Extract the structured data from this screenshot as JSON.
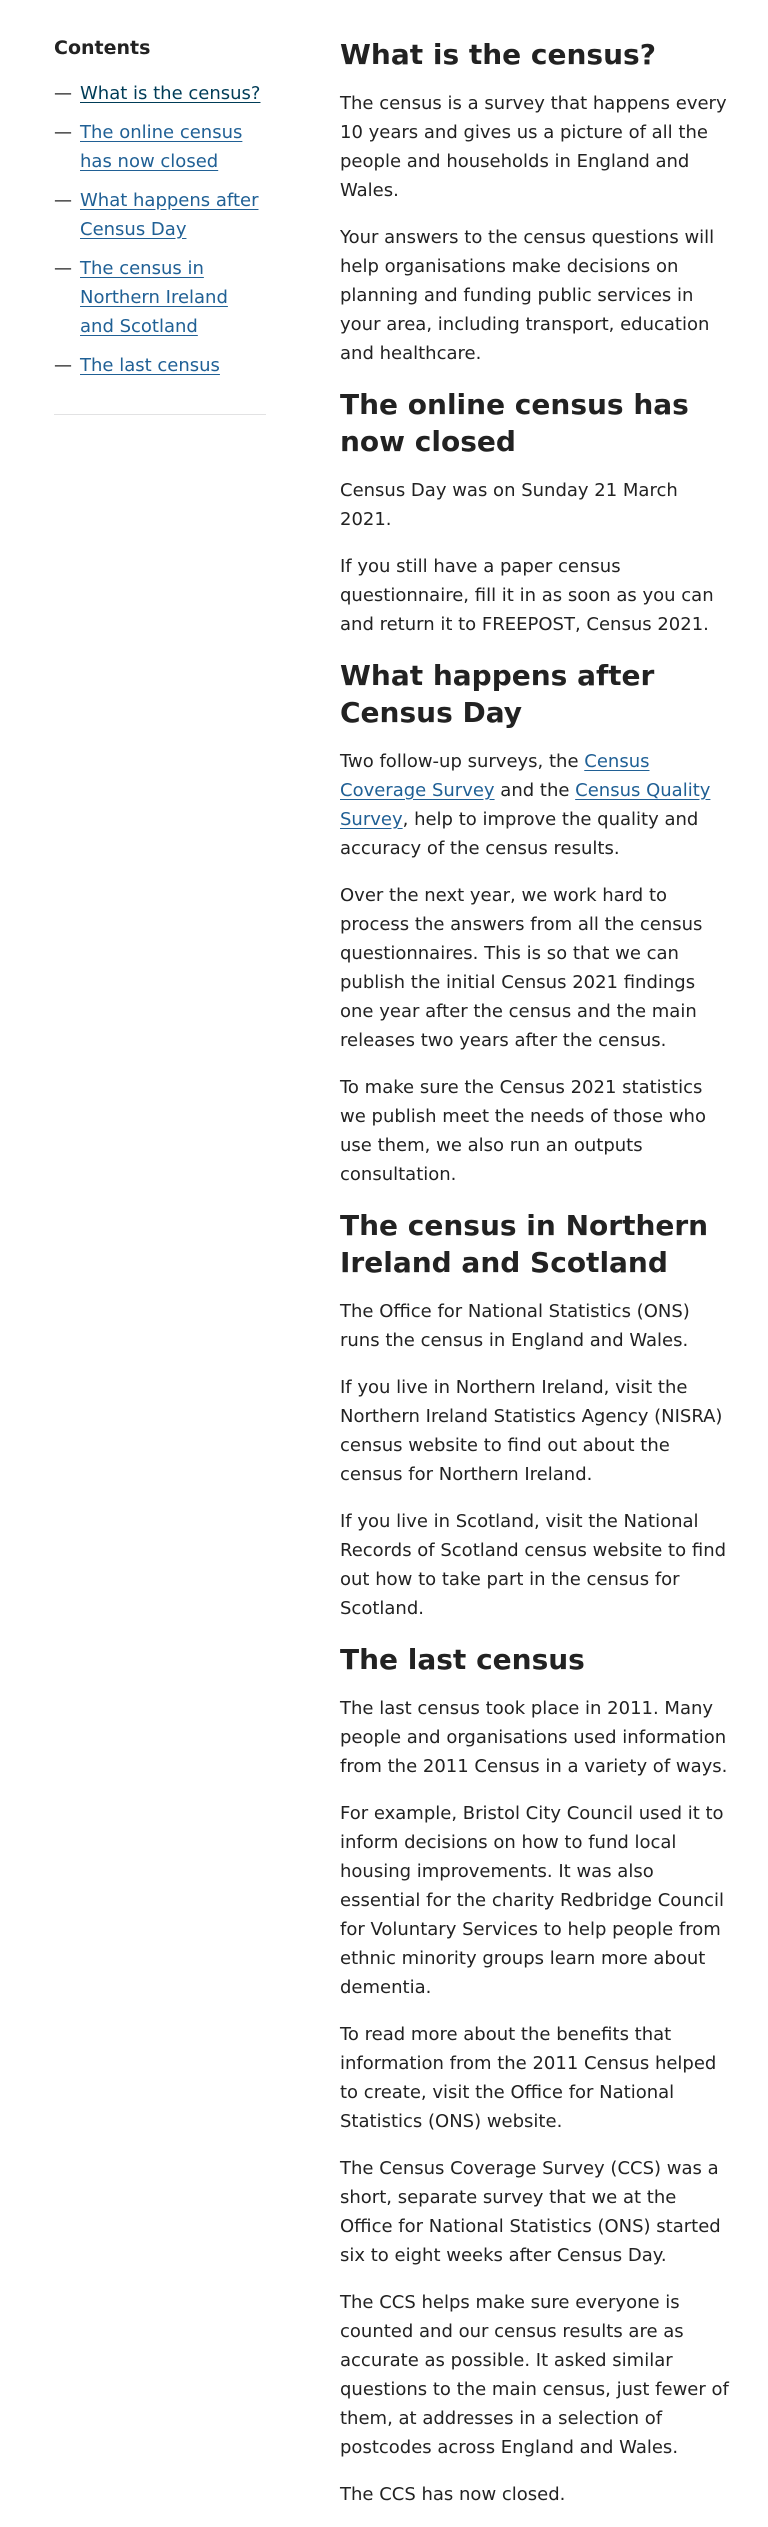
{
  "toc": {
    "title": "Contents",
    "dash": "—",
    "items": [
      {
        "label": "What is the census?"
      },
      {
        "label": "The online census has now closed"
      },
      {
        "label": "What happens after Census Day"
      },
      {
        "label": "The census in Northern Ireland and Scotland"
      },
      {
        "label": "The last census"
      }
    ]
  },
  "sections": {
    "what": {
      "heading": "What is the census?",
      "p1": "The census is a survey that happens every 10 years and gives us a picture of all the people and households in England and Wales.",
      "p2": "Your answers to the census questions will help organisations make decisions on planning and funding public services in your area, including transport, education and healthcare."
    },
    "online": {
      "heading": "The online census has now closed",
      "p1": "Census Day was on Sunday 21 March 2021.",
      "p2": "If you still have a paper census questionnaire, fill it in as soon as you can and return it to FREEPOST, Census 2021."
    },
    "after": {
      "heading": "What happens after Census Day",
      "p1_a": "Two follow-up surveys, the ",
      "p1_link1": "Census Coverage Survey",
      "p1_b": " and the ",
      "p1_link2": "Census Quality Survey",
      "p1_c": ", help to improve the quality and accuracy of the census results.",
      "p2": "Over the next year, we work hard to process the answers from all the census questionnaires. This is so that we can publish the initial Census 2021 findings one year after the census and the main releases two years after the census.",
      "p3": "To make sure the Census 2021 statistics we publish meet the needs of those who use them, we also run an outputs consultation."
    },
    "ni": {
      "heading": "The census in Northern Ireland and Scotland",
      "p1": "The Office for National Statistics (ONS) runs the census in England and Wales.",
      "p2": "If you live in Northern Ireland, visit the Northern Ireland Statistics Agency (NISRA) census website to find out about the census for Northern Ireland.",
      "p3": "If you live in Scotland, visit the National Records of Scotland census website to find out how to take part in the census for Scotland."
    },
    "last": {
      "heading": "The last census",
      "p1": "The last census took place in 2011. Many people and organisations used information from the 2011 Census in a variety of ways.",
      "p2": "For example, Bristol City Council used it to inform decisions on how to fund local housing improvements. It was also essential for the charity Redbridge Council for Voluntary Services to help people from ethnic minority groups learn more about dementia.",
      "p3": "To read more about the benefits that information from the 2011 Census helped to create, visit the Office for National Statistics (ONS) website.",
      "p4": "The Census Coverage Survey (CCS) was a short, separate survey that we at the Office for National Statistics (ONS) started six to eight weeks after Census Day.",
      "p5": "The CCS helps make sure everyone is counted and our census results are as accurate as possible. It asked similar questions to the main census, just fewer of them, at addresses in a selection of postcodes across England and Wales.",
      "p6": "The CCS has now closed."
    }
  },
  "colors": {
    "link": "#206095",
    "link_active": "#003c57",
    "text": "#222222",
    "rule": "#e2e2e3"
  }
}
